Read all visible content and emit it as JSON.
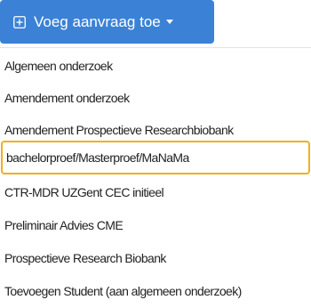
{
  "add_button": {
    "label": "Voeg aanvraag toe",
    "icon": "plus-square-icon",
    "caret_icon": "caret-down-icon",
    "background_color": "#3b82d6"
  },
  "menu": {
    "items": [
      {
        "label": "Algemeen onderzoek"
      },
      {
        "label": "Amendement onderzoek"
      },
      {
        "label": "Amendement Prospectieve Researchbiobank"
      },
      {
        "label": "bachelorproef/Masterproef/MaNaMa",
        "highlighted": true
      },
      {
        "label": "CTR-MDR UZGent CEC initieel"
      },
      {
        "label": "Preliminair Advies CME"
      },
      {
        "label": "Prospectieve Research Biobank"
      },
      {
        "label": "Toevoegen Student (aan algemeen onderzoek)"
      }
    ],
    "highlight_color": "#f2b01e"
  }
}
